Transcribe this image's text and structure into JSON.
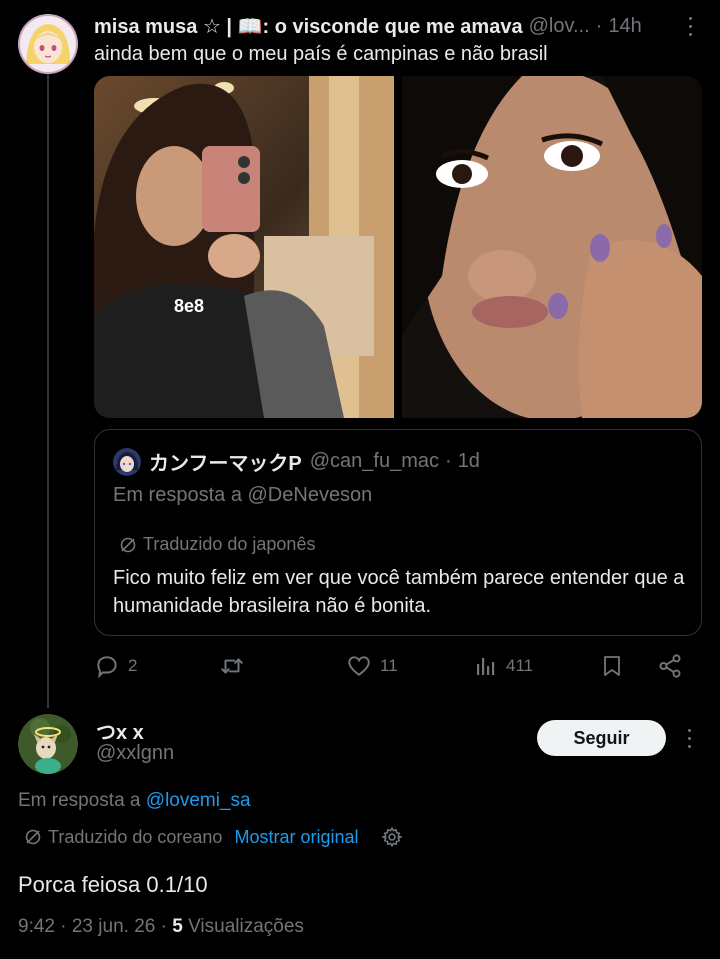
{
  "tweet": {
    "author_name": "misa musa ☆ | 📖: o visconde que me amava",
    "author_handle": "@lov...",
    "separator": "·",
    "time": "14h",
    "text": "ainda bem que o meu país é campinas e não brasil",
    "media_count": 2
  },
  "quote": {
    "author_name": "カンフーマックP",
    "author_handle": "@can_fu_mac",
    "separator": "·",
    "time": "1d",
    "replying_to": "Em resposta a @DeNeveson",
    "translated_label": "Traduzido do japonês",
    "text": "Fico muito feliz em ver que você também parece entender que a humanidade brasileira não é bonita."
  },
  "actions": {
    "replies": "2",
    "retweets": "",
    "likes": "11",
    "views": "411"
  },
  "reply": {
    "author_name": "つx x",
    "author_handle": "@xxlgnn",
    "follow_label": "Seguir",
    "replying_to_prefix": "Em resposta a",
    "replying_to_mention": "@lovemi_sa",
    "translated_label": "Traduzido do coreano",
    "show_original": "Mostrar original",
    "text": "Porca feiosa 0.1/10",
    "timestamp": "9:42 · 23 jun. 26 ·",
    "views_count": "5",
    "views_label": "Visualizações"
  },
  "colors": {
    "background": "#000000",
    "primary_text": "#e7e9ea",
    "secondary_text": "#71767b",
    "accent_blue": "#1d9bf0",
    "border": "#2f3336"
  }
}
